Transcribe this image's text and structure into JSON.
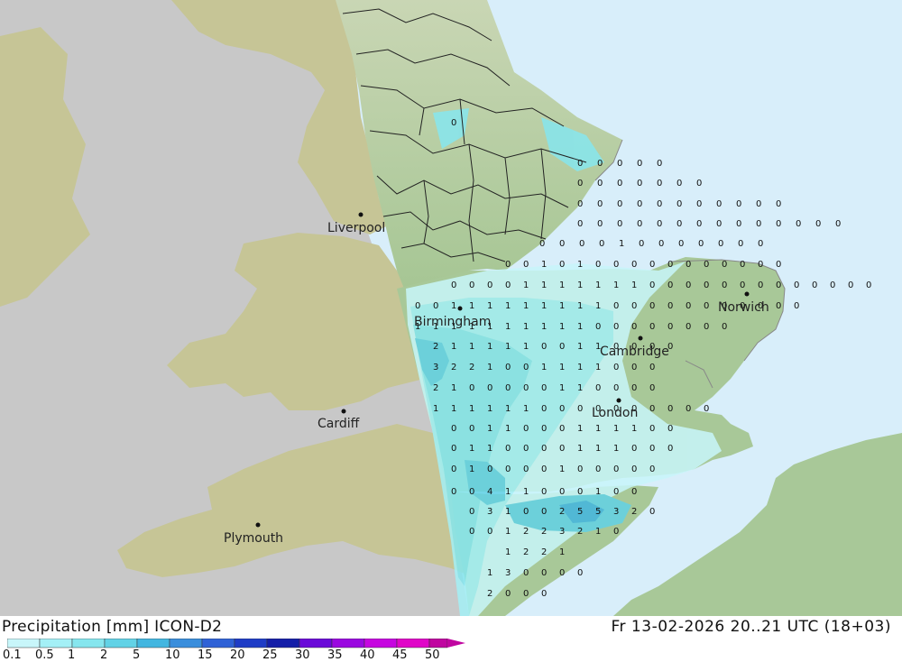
{
  "title": "Precipitation [mm] ICON-D2",
  "valid_time": "Fr 13-02-2026 20..21 UTC (18+03)",
  "cities": [
    {
      "name": "Liverpool"
    },
    {
      "name": "Birmingham"
    },
    {
      "name": "Norwich"
    },
    {
      "name": "Cambridge"
    },
    {
      "name": "London"
    },
    {
      "name": "Cardiff"
    },
    {
      "name": "Plymouth"
    }
  ],
  "legend": {
    "labels": [
      "0.1",
      "0.5",
      "1",
      "2",
      "5",
      "10",
      "15",
      "20",
      "25",
      "30",
      "35",
      "40",
      "45",
      "50"
    ],
    "colors": [
      "#c8f6fa",
      "#a4f0f6",
      "#86e6ee",
      "#62d2e6",
      "#42b6e0",
      "#3a8edc",
      "#2f62d6",
      "#1e3cc6",
      "#141ea8",
      "#6a0ad8",
      "#9a08e0",
      "#c606e0",
      "#e006c8",
      "#c006a0"
    ]
  },
  "colors": {
    "sea": "#d8eefa",
    "land": "#a8c898",
    "outside_domain": "#c8c8c8",
    "outside_land": "#c6c596"
  },
  "precip_grid": [
    "0",
    "0 0 0 0 0",
    "0 0 0 0 0 0 0",
    "0 0 0 0 0 0 0 0 0 0 0",
    "0 0 0 0 0 0 0 0 0 0 0 0 0 0",
    "0 0 0 0 1 0 0 0 0 0 0 0",
    "0 0 1 0 1 0 0 0 0 0 0 0 0 0 0 0",
    "0 0 0 0 1 1 1 1 1 1 1 0 0 0 0 0 0 0 0 0 0 0 0 0",
    "0 0 1 1 1 1 1 1 1 1 1 0 0 0 0 0 0 0 0 0 0 0",
    "1 1 1 1 1 1 1 1 1 1 0 0 0 0 0 0 0 0",
    "2 1 1 1 1 1 0 0 1 1 0 0 0 0",
    "3 2 2 1 0 0 1 1 1 1 0 0 0",
    "2 1 0 0 0 0 0 1 1 0 0 0 0",
    "1 1 1 1 1 1 0 0 0 0 0 0 0 0 0 0",
    "0 0 1 1 0 0 0 1 1 1 1 0 0",
    "0 1 1 0 0 0 0 1 1 1 0 0 0",
    "0 1 0 0 0 0 1 0 0 0 0 0",
    "0 0 4 1 1 0 0 0 1 0 0",
    "0 3 1 0 0 2 5 5 3 2 0",
    "0 0 1 2 2 3 2 1 0",
    "1 2 2 1",
    "1 3 0 0 0 0",
    "2 0 0 0"
  ]
}
